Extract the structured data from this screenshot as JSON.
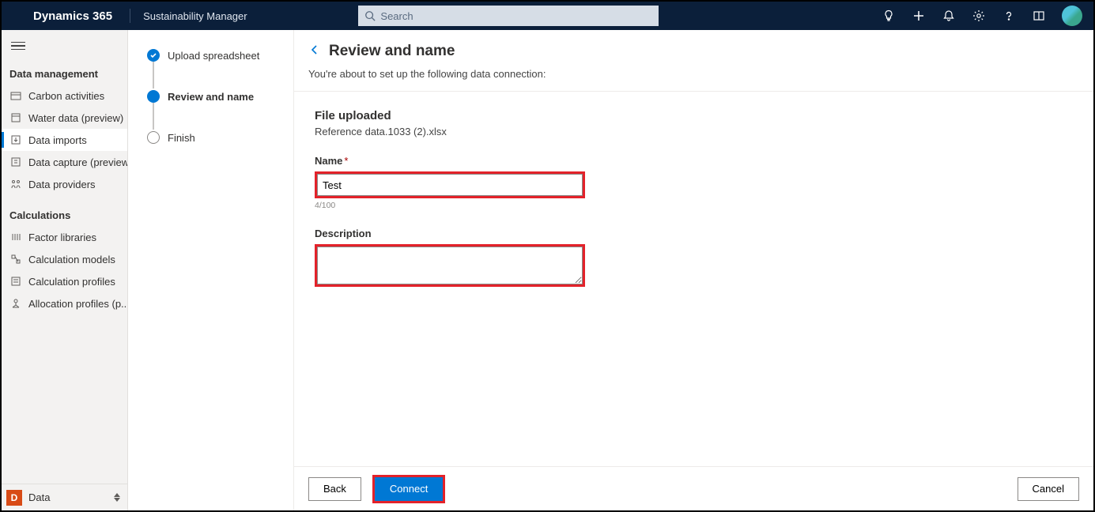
{
  "top": {
    "brand": "Dynamics 365",
    "app": "Sustainability Manager",
    "search_placeholder": "Search"
  },
  "sidebar": {
    "section_data": "Data management",
    "items_data": [
      "Carbon activities",
      "Water data (preview)",
      "Data imports",
      "Data capture (preview)",
      "Data providers"
    ],
    "section_calc": "Calculations",
    "items_calc": [
      "Factor libraries",
      "Calculation models",
      "Calculation profiles",
      "Allocation profiles (p..."
    ],
    "area_badge": "D",
    "area_name": "Data"
  },
  "steps": {
    "s1": "Upload spreadsheet",
    "s2": "Review and name",
    "s3": "Finish"
  },
  "main": {
    "title": "Review and name",
    "subtitle": "You're about to set up the following data connection:",
    "file_heading": "File uploaded",
    "file_name": "Reference data.1033 (2).xlsx",
    "name_label": "Name",
    "name_value": "Test",
    "name_count": "4/100",
    "desc_label": "Description",
    "desc_value": ""
  },
  "buttons": {
    "back": "Back",
    "connect": "Connect",
    "cancel": "Cancel"
  }
}
